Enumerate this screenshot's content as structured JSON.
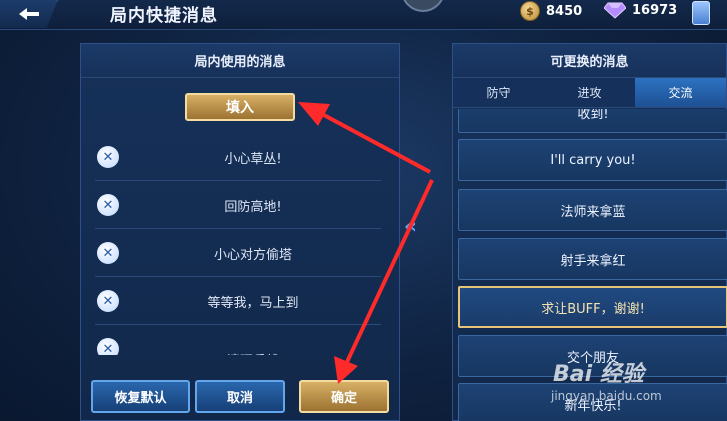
{
  "header": {
    "title": "局内快捷消息",
    "gold": "8450",
    "gems": "16973"
  },
  "left_panel": {
    "title": "局内使用的消息",
    "fill_button": "填入",
    "messages": [
      "小心草丛!",
      "回防高地!",
      "小心对方偷塔",
      "等等我，马上到",
      "清理兵线"
    ],
    "buttons": {
      "reset": "恢复默认",
      "cancel": "取消",
      "confirm": "确定"
    }
  },
  "right_panel": {
    "title": "可更换的消息",
    "tabs": [
      "防守",
      "进攻",
      "交流"
    ],
    "active_tab": "交流",
    "options": [
      "收到!",
      "I'll carry you!",
      "法师来拿蓝",
      "射手来拿红",
      "求让BUFF，谢谢!",
      "交个朋友",
      "新年快乐!"
    ],
    "selected_option": "求让BUFF，谢谢!"
  },
  "watermark": {
    "text": "Bai 经验",
    "url": "jingyan.baidu.com"
  },
  "colors": {
    "gold_button": "#c79a4f",
    "blue_button": "#2a67ad",
    "annotation_arrow": "#ff2a2a",
    "selected_border": "#e6c57a"
  }
}
